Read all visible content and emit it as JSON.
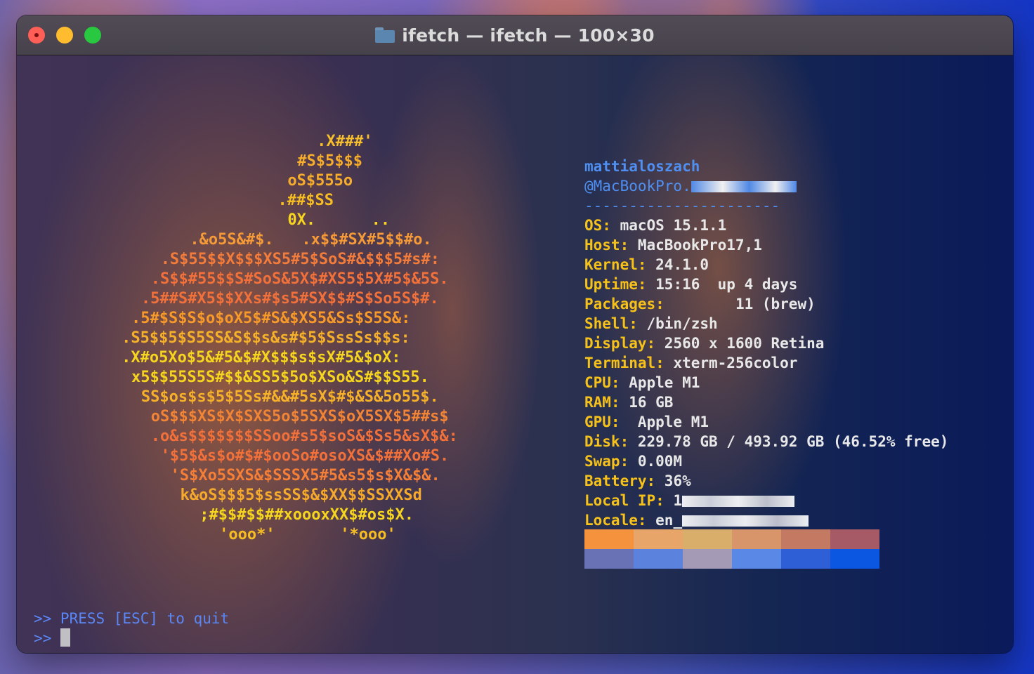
{
  "window": {
    "title": "ifetch — ifetch — 100×30"
  },
  "ascii_art": [
    {
      "text": ".X###'",
      "color": "#f7bf2b",
      "indent": 29
    },
    {
      "text": "#S$5$$$",
      "color": "#f6ad2c",
      "indent": 27
    },
    {
      "text": "oS$555o",
      "color": "#f6ad2c",
      "indent": 26
    },
    {
      "text": ".##$SS",
      "color": "#f6bd23",
      "indent": 25
    },
    {
      "text": "0X.      ..",
      "color": "#f7d51e",
      "indent": 26
    },
    {
      "text": ".&o5S&#$.   .x$$#SX#5$$#o.",
      "color": "#f59a37",
      "indent": 16
    },
    {
      "text": ".S$55$$X$$$XS5#5$SoS#&$$$5#s#:",
      "color": "#f47c3a",
      "indent": 13
    },
    {
      "text": ".S$$#55$$S#SoS&5X$#XS5$5X#5$&5S.",
      "color": "#f2713b",
      "indent": 12
    },
    {
      "text": ".5##S#X5$$XXs#$s5#SX$$#S$So5S$#.",
      "color": "#f2713b",
      "indent": 11
    },
    {
      "text": ".5#$S$S$o$oX5$#S&$XS5&Ss$S5S&:",
      "color": "#f79a2a",
      "indent": 10
    },
    {
      "text": ".S5$$5$S5SS&S$$s&s#$5$SssSs$$s:",
      "color": "#f6b12b",
      "indent": 9
    },
    {
      "text": ".X#o5Xo$5&#5&$#X$$$s$sX#5&$oX:",
      "color": "#f6d51f",
      "indent": 9
    },
    {
      "text": "x5$$55S5S#$$&SS5$5o$XSo&S#$$S55.",
      "color": "#f6d51f",
      "indent": 10
    },
    {
      "text": "SS$os$s$5$5Ss#&&#5sX$#$&S&5o55$.",
      "color": "#f6b12b",
      "indent": 11
    },
    {
      "text": "oS$$$XS$X$SXS5o$5SXS$oX5SX$5##s$",
      "color": "#f28436",
      "indent": 12
    },
    {
      "text": ".o&s$$$$$$$SSoo#s5$soS&$Ss5&sX$&:",
      "color": "#f2713b",
      "indent": 12
    },
    {
      "text": "'$5$&s$o#$#$ooSo#osoXS&$##Xo#S.",
      "color": "#f2713b",
      "indent": 13
    },
    {
      "text": "'S$Xo5SXS&$SSSX5#5&s5$s$X&$&.",
      "color": "#f57f37",
      "indent": 14
    },
    {
      "text": "k&oS$$$5$ssSS$&$XX$$SSXXSd",
      "color": "#f6aa2c",
      "indent": 15
    },
    {
      "text": ";#$$#$$##xoooxXX$#os$X.",
      "color": "#f6d51f",
      "indent": 17
    },
    {
      "text": "'ooo*'       '*ooo'",
      "color": "#f6bd23",
      "indent": 19
    }
  ],
  "info": {
    "user": "mattialoszach",
    "host": "@MacBookPro.",
    "separator": "----------------------",
    "fields": [
      {
        "key": "OS:",
        "value": " macOS 15.1.1"
      },
      {
        "key": "Host:",
        "value": " MacBookPro17,1"
      },
      {
        "key": "Kernel:",
        "value": " 24.1.0"
      },
      {
        "key": "Uptime:",
        "value": " 15:16  up 4 days"
      },
      {
        "key": "Packages:",
        "value": "        11 (brew)"
      },
      {
        "key": "Shell:",
        "value": " /bin/zsh"
      },
      {
        "key": "Display:",
        "value": " 2560 x 1600 Retina"
      },
      {
        "key": "Terminal:",
        "value": " xterm-256color"
      },
      {
        "key": "CPU:",
        "value": " Apple M1"
      },
      {
        "key": "RAM:",
        "value": " 16 GB"
      },
      {
        "key": "GPU:",
        "value": "  Apple M1"
      },
      {
        "key": "Disk:",
        "value": " 229.78 GB / 493.92 GB (46.52% free)"
      },
      {
        "key": "Swap:",
        "value": " 0.00M"
      },
      {
        "key": "Battery:",
        "value": " 36%"
      },
      {
        "key": "Local IP:",
        "value": " 1"
      },
      {
        "key": "Locale:",
        "value": " en_"
      }
    ]
  },
  "palette": {
    "row1": [
      "#f5923e",
      "#e7a56a",
      "#d9ad6a",
      "#d9956a",
      "#c47a62",
      "#a65a66"
    ],
    "row2": [
      "#6872b4",
      "#5b82dc",
      "#a49ab6",
      "#5a88e6",
      "#2f5fd6",
      "#0c57e2"
    ]
  },
  "prompt": {
    "line1": ">> PRESS [ESC] to quit",
    "line2": ">> "
  }
}
